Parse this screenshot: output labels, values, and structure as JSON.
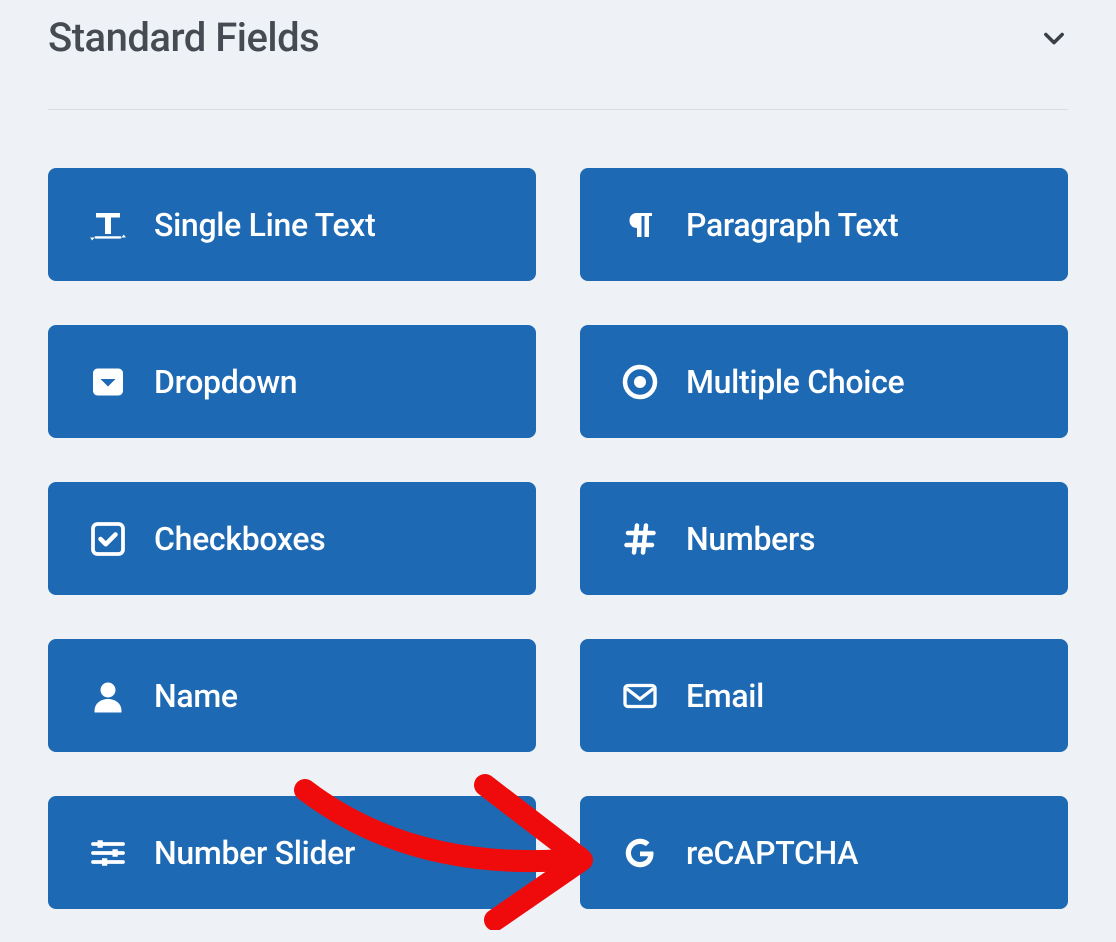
{
  "section": {
    "title": "Standard Fields"
  },
  "fields": [
    {
      "icon": "text-cursor-icon",
      "label": "Single Line Text"
    },
    {
      "icon": "paragraph-icon",
      "label": "Paragraph Text"
    },
    {
      "icon": "dropdown-icon",
      "label": "Dropdown"
    },
    {
      "icon": "radio-icon",
      "label": "Multiple Choice"
    },
    {
      "icon": "checkbox-icon",
      "label": "Checkboxes"
    },
    {
      "icon": "hash-icon",
      "label": "Numbers"
    },
    {
      "icon": "user-icon",
      "label": "Name"
    },
    {
      "icon": "envelope-icon",
      "label": "Email"
    },
    {
      "icon": "sliders-icon",
      "label": "Number Slider"
    },
    {
      "icon": "google-g-icon",
      "label": "reCAPTCHA"
    }
  ],
  "annotation": {
    "arrow_color": "#ef0b0b",
    "target_field_index": 9
  }
}
